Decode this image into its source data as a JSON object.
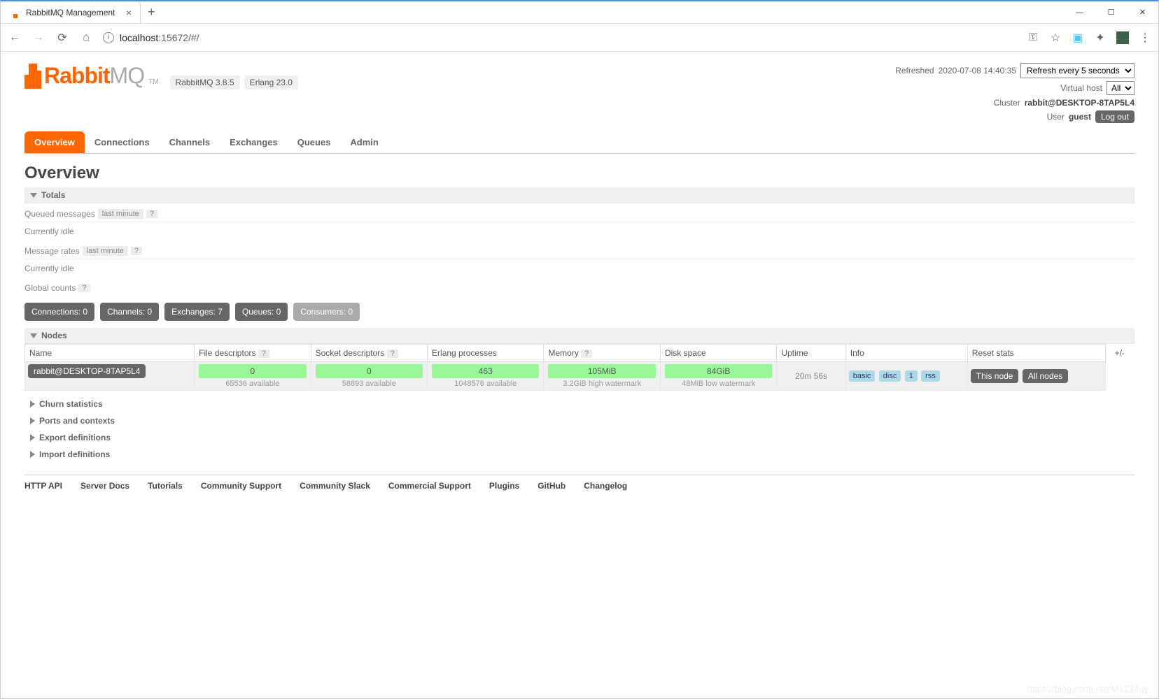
{
  "browser": {
    "tab_title": "RabbitMQ Management",
    "url_host": "localhost",
    "url_port_path": ":15672/#/"
  },
  "top_right": {
    "refreshed_label": "Refreshed",
    "refreshed_time": "2020-07-08 14:40:35",
    "refresh_select": "Refresh every 5 seconds",
    "vhost_label": "Virtual host",
    "vhost_value": "All",
    "cluster_label": "Cluster",
    "cluster_name": "rabbit@DESKTOP-8TAP5L4",
    "user_label": "User",
    "user_name": "guest",
    "logout": "Log out"
  },
  "logo": {
    "rabbit": "Rabbit",
    "mq": "MQ",
    "tm": "TM"
  },
  "versions": {
    "rabbitmq": "RabbitMQ 3.8.5",
    "erlang": "Erlang 23.0"
  },
  "nav": {
    "overview": "Overview",
    "connections": "Connections",
    "channels": "Channels",
    "exchanges": "Exchanges",
    "queues": "Queues",
    "admin": "Admin"
  },
  "page_title": "Overview",
  "totals": {
    "header": "Totals",
    "queued_label": "Queued messages",
    "queued_suffix": "last minute",
    "queued_idle": "Currently idle",
    "rates_label": "Message rates",
    "rates_suffix": "last minute",
    "rates_idle": "Currently idle",
    "global_counts_label": "Global counts"
  },
  "counts": {
    "connections": {
      "label": "Connections:",
      "value": "0"
    },
    "channels": {
      "label": "Channels:",
      "value": "0"
    },
    "exchanges": {
      "label": "Exchanges:",
      "value": "7"
    },
    "queues": {
      "label": "Queues:",
      "value": "0"
    },
    "consumers": {
      "label": "Consumers:",
      "value": "0"
    }
  },
  "nodes": {
    "header": "Nodes",
    "cols": {
      "name": "Name",
      "fd": "File descriptors",
      "sd": "Socket descriptors",
      "erlang": "Erlang processes",
      "memory": "Memory",
      "disk": "Disk space",
      "uptime": "Uptime",
      "info": "Info",
      "reset": "Reset stats",
      "pm": "+/-"
    },
    "row": {
      "name": "rabbit@DESKTOP-8TAP5L4",
      "fd_val": "0",
      "fd_avail": "65536 available",
      "sd_val": "0",
      "sd_avail": "58893 available",
      "erlang_val": "463",
      "erlang_avail": "1048576 available",
      "mem_val": "105MiB",
      "mem_avail": "3.2GiB high watermark",
      "disk_val": "84GiB",
      "disk_avail": "48MiB low watermark",
      "uptime": "20m 56s",
      "info_basic": "basic",
      "info_disc": "disc",
      "info_1": "1",
      "info_rss": "rss",
      "reset_this": "This node",
      "reset_all": "All nodes"
    }
  },
  "collapsed_sections": {
    "churn": "Churn statistics",
    "ports": "Ports and contexts",
    "export": "Export definitions",
    "import": "Import definitions"
  },
  "footer": {
    "http_api": "HTTP API",
    "server_docs": "Server Docs",
    "tutorials": "Tutorials",
    "community_support": "Community Support",
    "community_slack": "Community Slack",
    "commercial_support": "Commercial Support",
    "plugins": "Plugins",
    "github": "GitHub",
    "changelog": "Changelog"
  },
  "watermark": "https://blog.csdn.net/M1234uy"
}
